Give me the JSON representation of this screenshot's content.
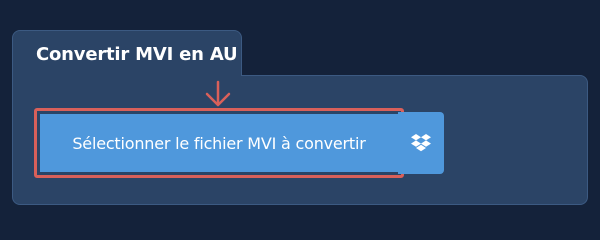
{
  "panel": {
    "title": "Convertir MVI en AU"
  },
  "actions": {
    "select_file_label": "Sélectionner le fichier MVI à convertir",
    "dropbox_icon": "dropbox-icon"
  },
  "colors": {
    "background": "#14223a",
    "panel": "#2b4466",
    "button": "#4f98dc",
    "highlight": "#d9605a"
  }
}
